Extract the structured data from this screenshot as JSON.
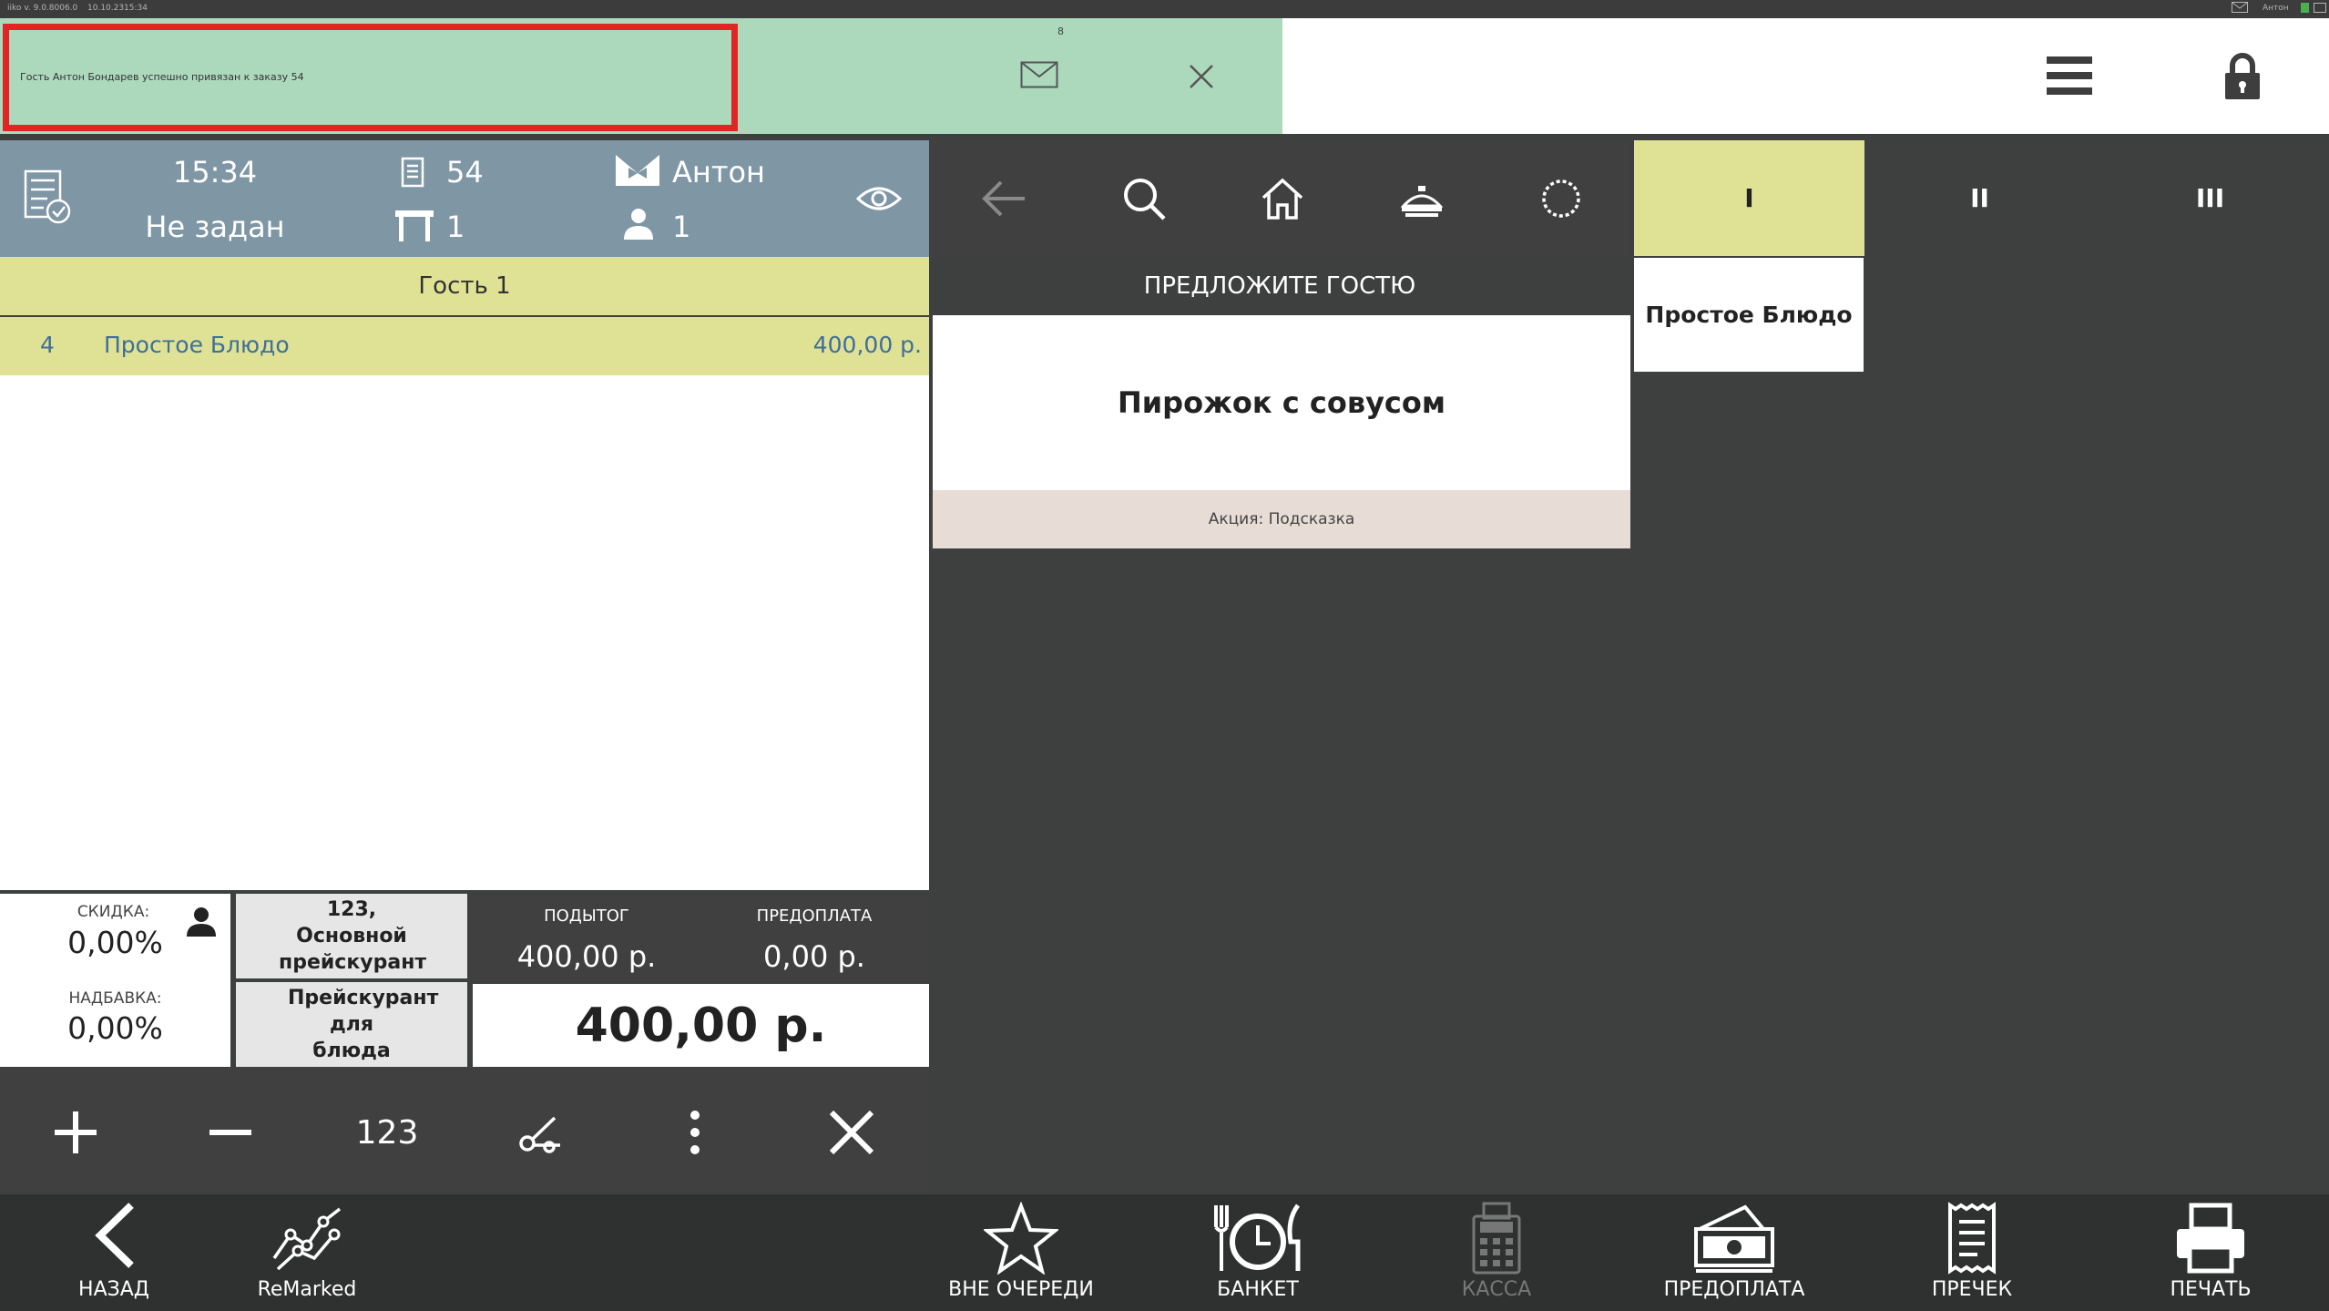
{
  "status_bar": {
    "version": "iiko v. 9.0.8006.0",
    "date": "10.10.23",
    "time": "15:34",
    "user": "Антон"
  },
  "notification": {
    "message": "Гость Антон Бондарев успешно привязан к заказу 54",
    "count": "8",
    "highlight_color": "#e12424"
  },
  "order_info": {
    "time": "15:34",
    "status": "Не задан",
    "order_number": "54",
    "table": "1",
    "waiter": "Антон",
    "guests": "1"
  },
  "guest": {
    "label": "Гость 1"
  },
  "order_items": [
    {
      "qty": "4",
      "name": "Простое Блюдо",
      "price": "400,00 р."
    }
  ],
  "totals": {
    "discount_label": "СКИДКА:",
    "discount_value": "0,00%",
    "surcharge_label": "НАДБАВКА:",
    "surcharge_value": "0,00%",
    "pricelist_label": "123, Основной прейскурант",
    "dish_pricelist_label": "Прейскурант для блюда",
    "subtotal_label": "ПОДЫТОГ",
    "subtotal_value": "400,00 р.",
    "prepay_label": "ПРЕДОПЛАТА",
    "prepay_value": "0,00 р.",
    "total": "400,00 р."
  },
  "actions": {
    "qty_label": "123"
  },
  "suggest": {
    "title": "ПРЕДЛОЖИТЕ ГОСТЮ",
    "item": "Пирожок с совусом",
    "promo": "Акция: Подсказка"
  },
  "courses": {
    "tabs": [
      "I",
      "II",
      "III"
    ],
    "dish": "Простое Блюдо",
    "active_color": "#dfe295"
  },
  "bottom_bar": {
    "back": "НАЗАД",
    "remarked": "ReMarked",
    "priority": "ВНЕ ОЧЕРЕДИ",
    "banquet": "БАНКЕТ",
    "cashier": "КАССА",
    "prepay": "ПРЕДОПЛАТА",
    "precheck": "ПРЕЧЕК",
    "print": "ПЕЧАТЬ"
  }
}
